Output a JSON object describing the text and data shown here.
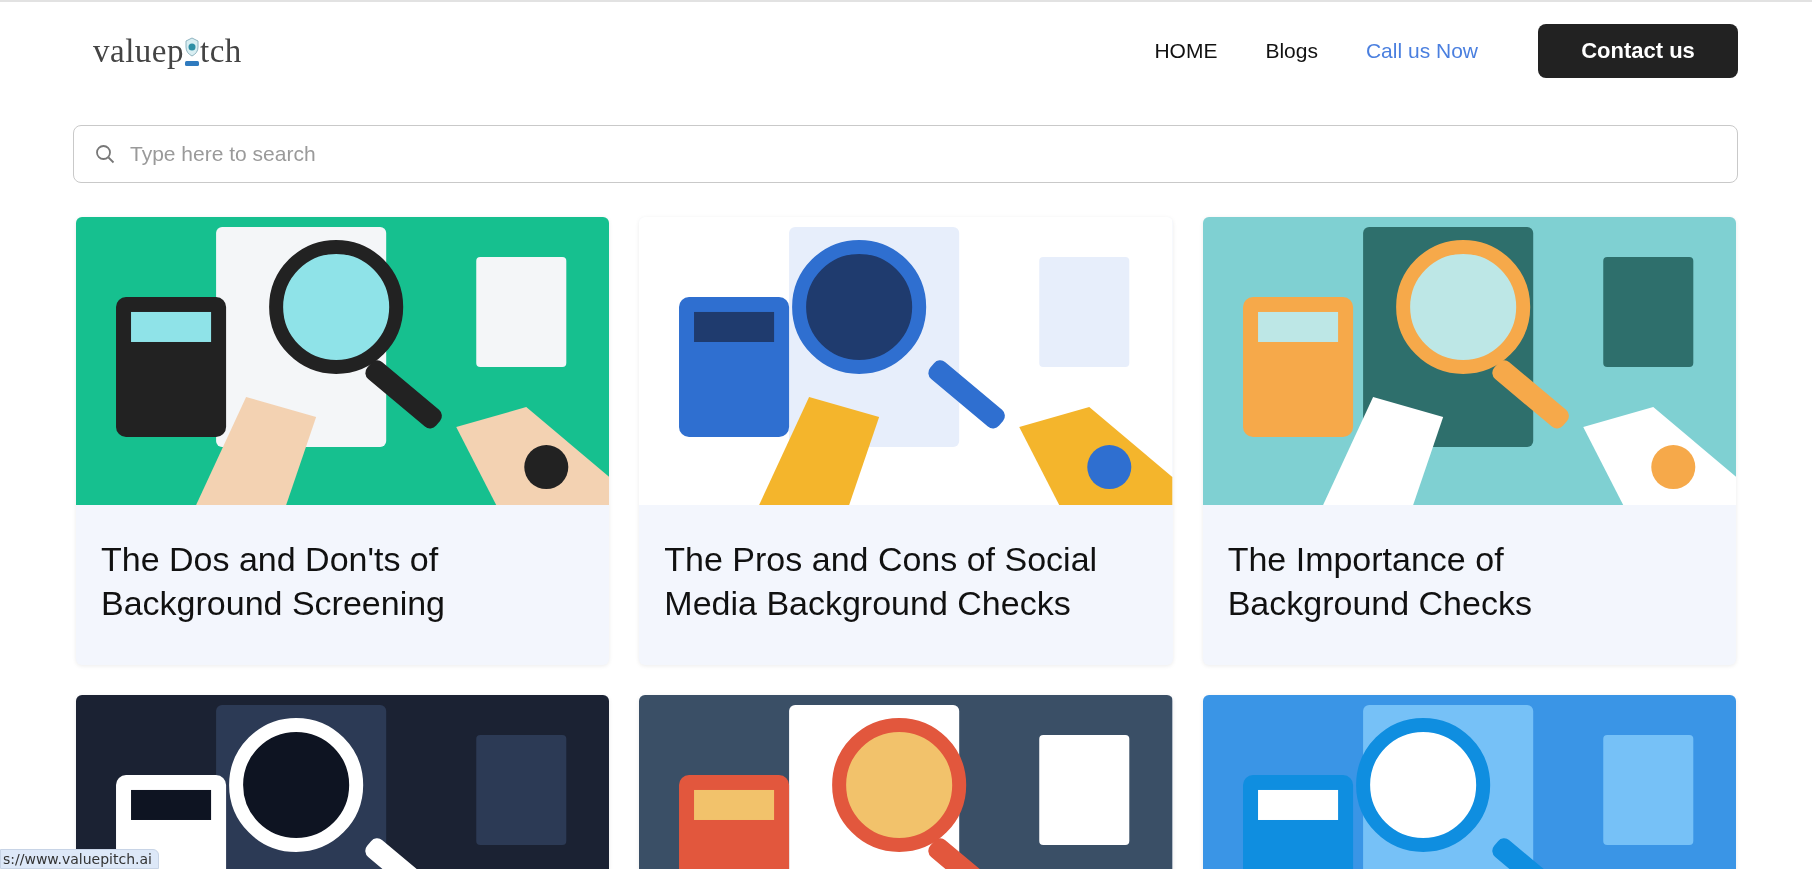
{
  "logo": {
    "text_before": "valuep",
    "text_after": "tch"
  },
  "nav": {
    "links": [
      {
        "label": "HOME",
        "kind": "plain"
      },
      {
        "label": "Blogs",
        "kind": "plain"
      },
      {
        "label": "Call us Now",
        "kind": "accent"
      }
    ],
    "button": "Contact us"
  },
  "search": {
    "placeholder": "Type here to search"
  },
  "posts": [
    {
      "title": "The Dos and Don'ts of Background Screening",
      "image": {
        "kind": "picture"
      }
    },
    {
      "title": "The Pros and Cons of Social Media Background Checks",
      "image": {
        "kind": "picture"
      }
    },
    {
      "title": "The Importance of Background Checks",
      "image": {
        "kind": "picture"
      }
    },
    {
      "image": {
        "kind": "picture"
      }
    },
    {
      "image": {
        "kind": "picture"
      }
    },
    {
      "image": {
        "kind": "picture"
      }
    }
  ],
  "status_bar": {
    "url": "s://www.valuepitch.ai"
  }
}
